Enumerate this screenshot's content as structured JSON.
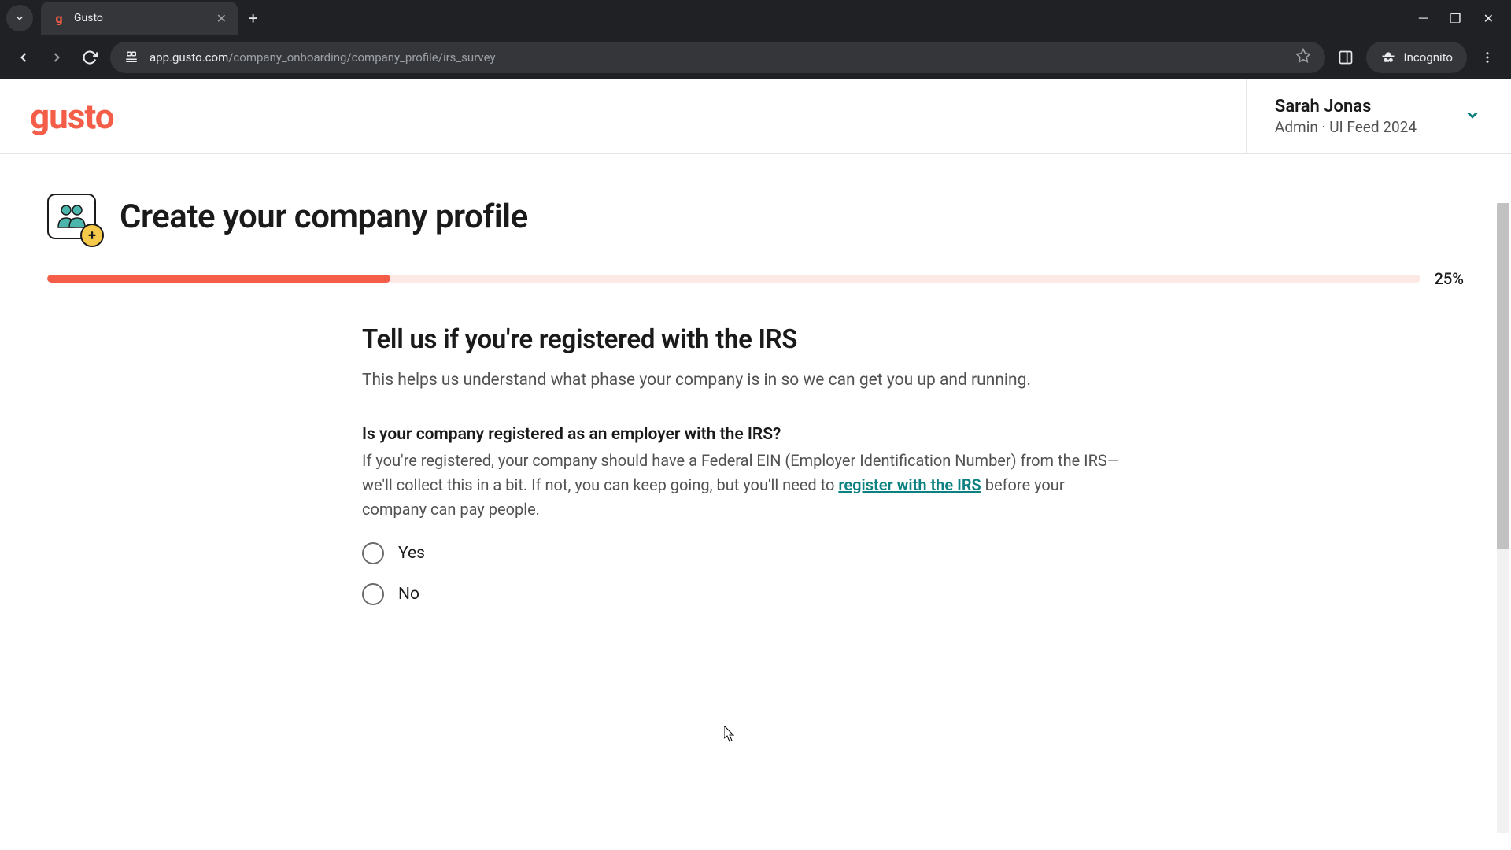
{
  "browser": {
    "tab_title": "Gusto",
    "url_display_host": "app.gusto.com",
    "url_display_path": "/company_onboarding/company_profile/irs_survey",
    "incognito_label": "Incognito"
  },
  "header": {
    "logo_text": "gusto",
    "user_name": "Sarah Jonas",
    "user_role": "Admin · UI Feed 2024"
  },
  "page": {
    "title": "Create your company profile",
    "progress_percent": 25,
    "progress_label": "25%"
  },
  "form": {
    "section_title": "Tell us if you're registered with the IRS",
    "section_desc": "This helps us understand what phase your company is in so we can get you up and running.",
    "question_label": "Is your company registered as an employer with the IRS?",
    "question_help_1": "If you're registered, your company should have a Federal EIN (Employer Identification Number) from the IRS—we'll collect this in a bit. If not, you can keep going, but you'll need to ",
    "question_help_link": "register with the IRS",
    "question_help_2": " before your company can pay people.",
    "options": [
      {
        "label": "Yes"
      },
      {
        "label": "No"
      }
    ]
  },
  "colors": {
    "brand": "#f45d48",
    "teal": "#0a8080",
    "progress_bg": "#fce8e4"
  }
}
